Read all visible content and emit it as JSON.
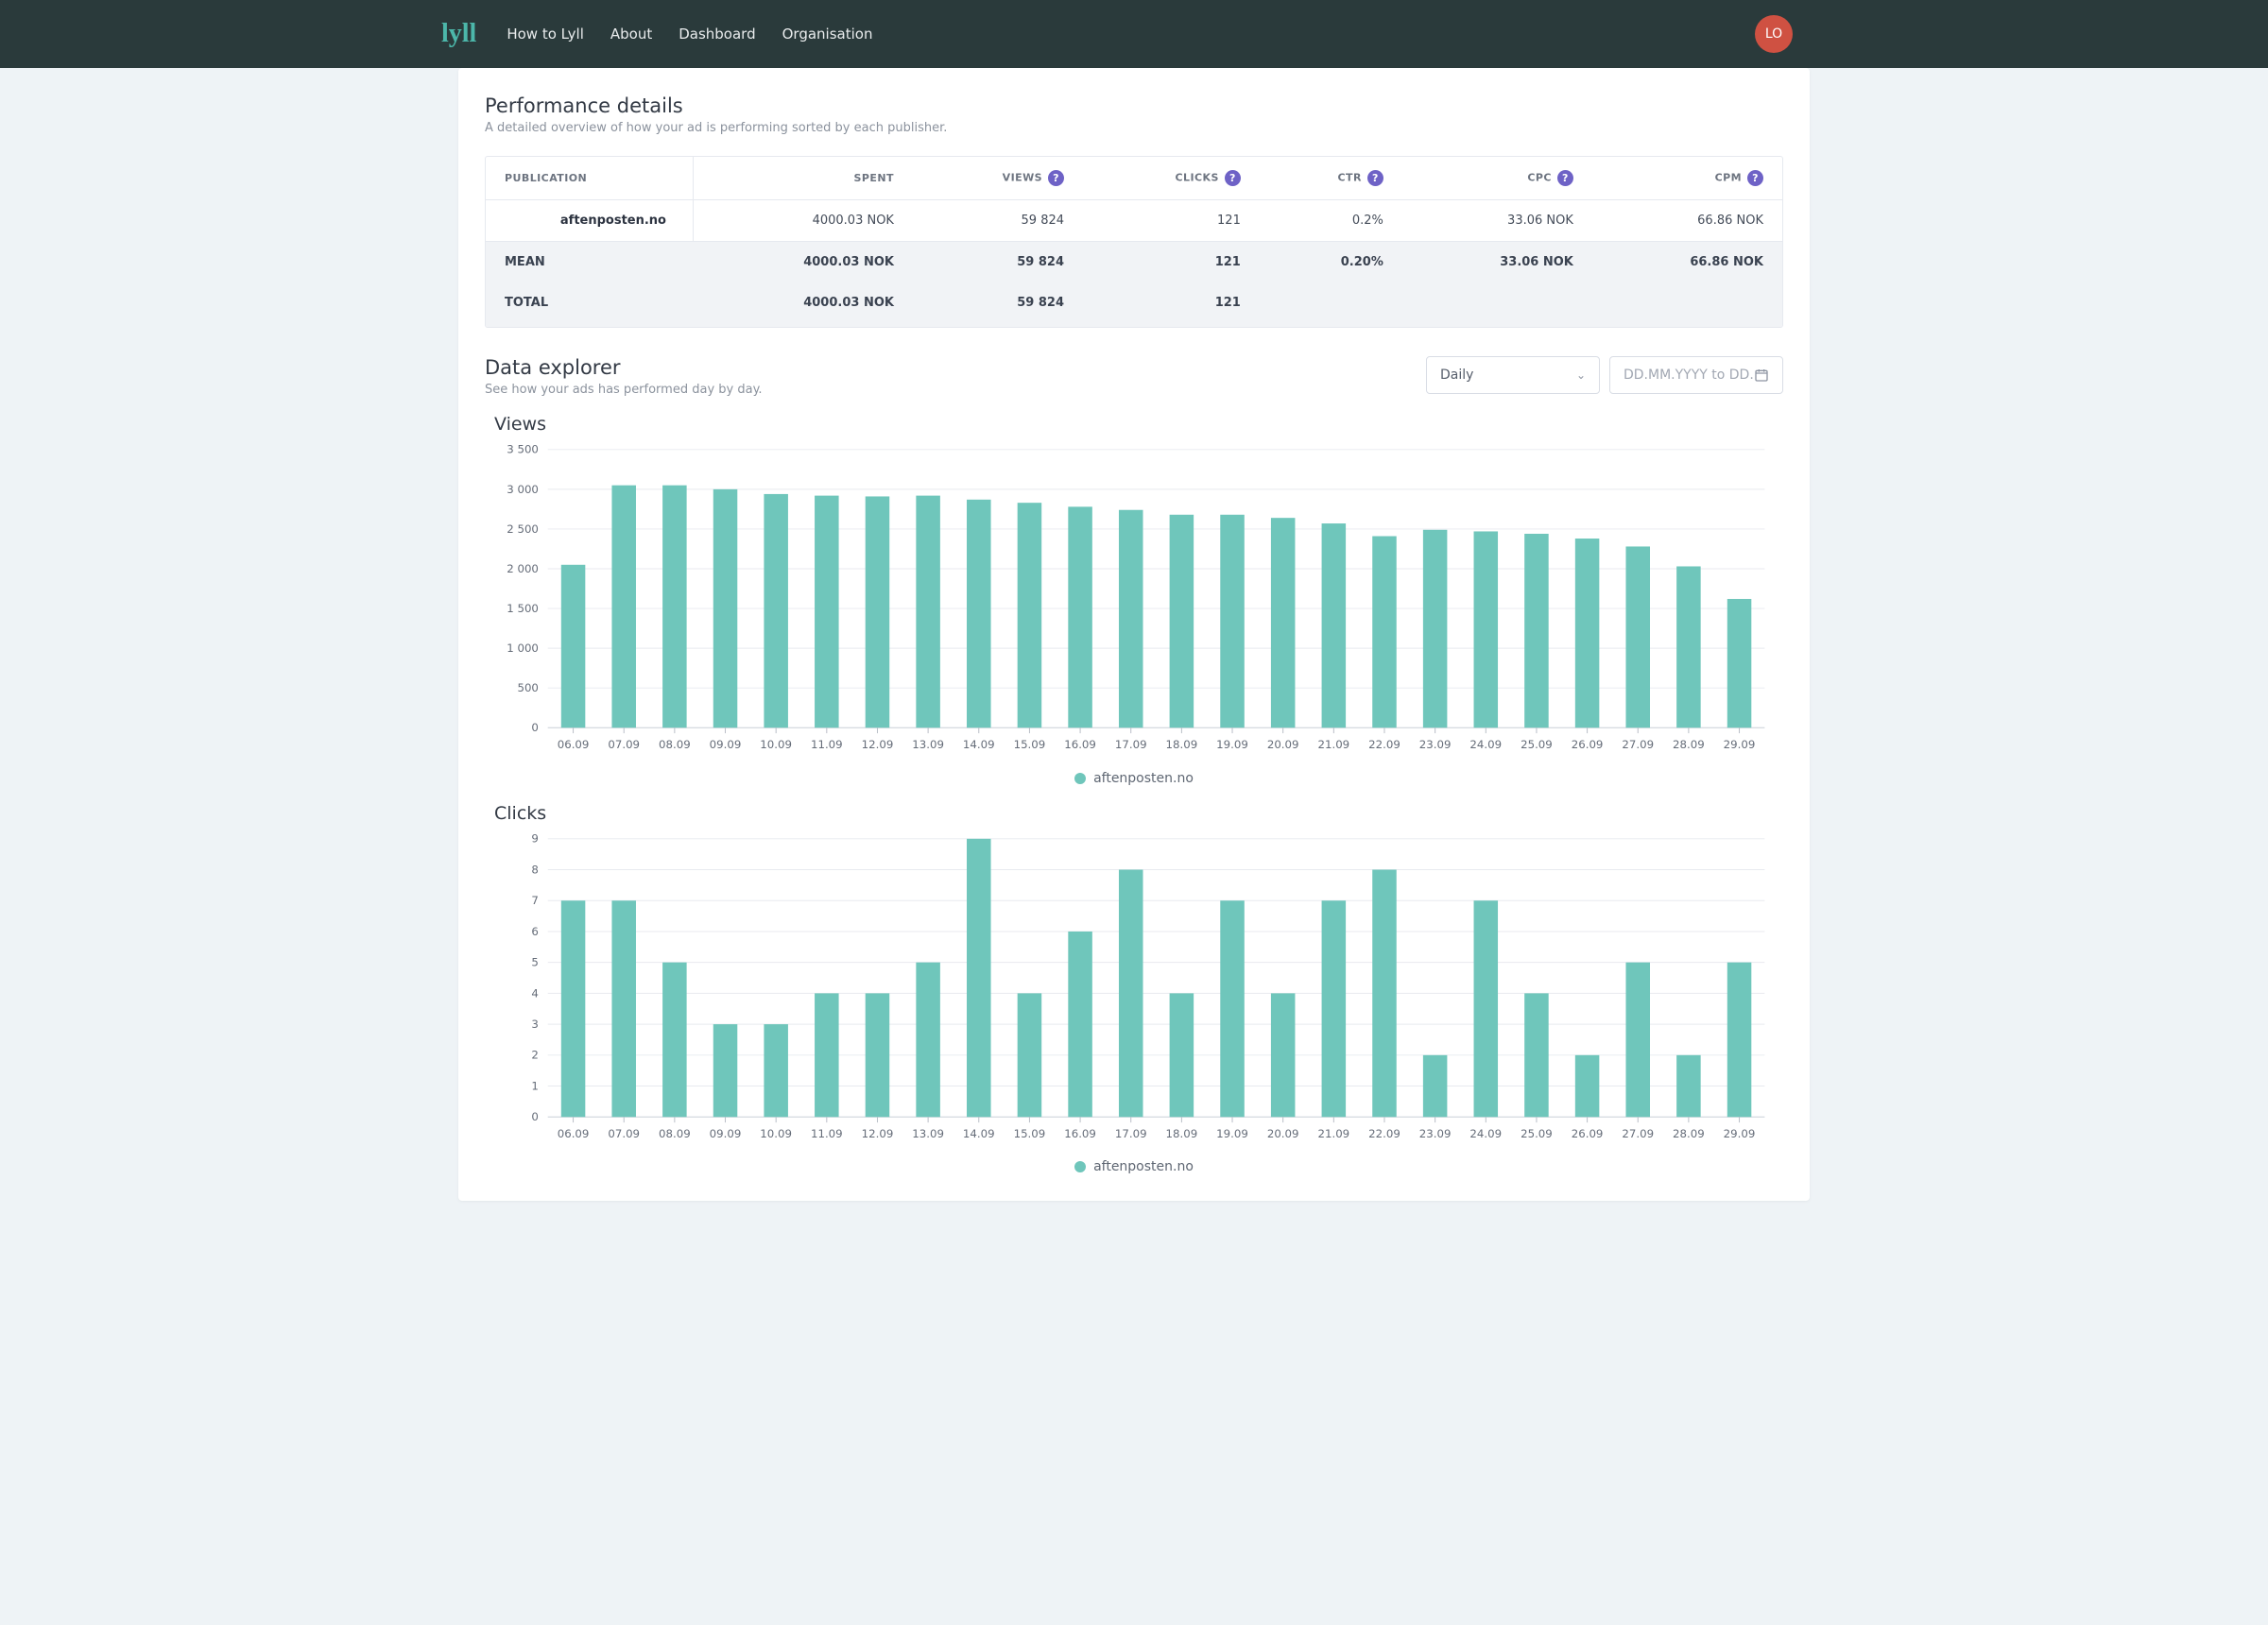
{
  "brand": "lyll",
  "nav": [
    "How to Lyll",
    "About",
    "Dashboard",
    "Organisation"
  ],
  "avatar_initials": "LO",
  "perf": {
    "title": "Performance details",
    "subtitle": "A detailed overview of how your ad is performing sorted by each publisher.",
    "columns": [
      {
        "label": "PUBLICATION",
        "help": false
      },
      {
        "label": "SPENT",
        "help": false
      },
      {
        "label": "VIEWS",
        "help": true
      },
      {
        "label": "CLICKS",
        "help": true
      },
      {
        "label": "CTR",
        "help": true
      },
      {
        "label": "CPC",
        "help": true
      },
      {
        "label": "CPM",
        "help": true
      }
    ],
    "rows": [
      {
        "publication": "aftenposten.no",
        "spent": "4000.03 NOK",
        "views": "59 824",
        "clicks": "121",
        "ctr": "0.2%",
        "cpc": "33.06 NOK",
        "cpm": "66.86 NOK"
      }
    ],
    "summary": [
      {
        "label": "MEAN",
        "spent": "4000.03 NOK",
        "views": "59 824",
        "clicks": "121",
        "ctr": "0.20%",
        "cpc": "33.06 NOK",
        "cpm": "66.86 NOK"
      },
      {
        "label": "TOTAL",
        "spent": "4000.03 NOK",
        "views": "59 824",
        "clicks": "121",
        "ctr": "",
        "cpc": "",
        "cpm": ""
      }
    ]
  },
  "explorer": {
    "title": "Data explorer",
    "subtitle": "See how your ads has performed day by day.",
    "granularity_label": "Daily",
    "date_placeholder": "DD.MM.YYYY to DD.MM.YYYY"
  },
  "legend_series": "aftenposten.no",
  "chart_data": [
    {
      "type": "bar",
      "title": "Views",
      "xlabel": "",
      "ylabel": "",
      "ylim": [
        0,
        3500
      ],
      "yticks": [
        0,
        500,
        1000,
        1500,
        2000,
        2500,
        3000,
        3500
      ],
      "ytick_labels": [
        "0",
        "500",
        "1 000",
        "1 500",
        "2 000",
        "2 500",
        "3 000",
        "3 500"
      ],
      "categories": [
        "06.09",
        "07.09",
        "08.09",
        "09.09",
        "10.09",
        "11.09",
        "12.09",
        "13.09",
        "14.09",
        "15.09",
        "16.09",
        "17.09",
        "18.09",
        "19.09",
        "20.09",
        "21.09",
        "22.09",
        "23.09",
        "24.09",
        "25.09",
        "26.09",
        "27.09",
        "28.09",
        "29.09"
      ],
      "series": [
        {
          "name": "aftenposten.no",
          "values": [
            2050,
            3050,
            3050,
            3000,
            2940,
            2920,
            2910,
            2920,
            2870,
            2830,
            2780,
            2740,
            2680,
            2680,
            2640,
            2570,
            2410,
            2490,
            2470,
            2440,
            2380,
            2280,
            2030,
            1620
          ]
        }
      ]
    },
    {
      "type": "bar",
      "title": "Clicks",
      "xlabel": "",
      "ylabel": "",
      "ylim": [
        0,
        9
      ],
      "yticks": [
        0,
        1,
        2,
        3,
        4,
        5,
        6,
        7,
        8,
        9
      ],
      "ytick_labels": [
        "0",
        "1",
        "2",
        "3",
        "4",
        "5",
        "6",
        "7",
        "8",
        "9"
      ],
      "categories": [
        "06.09",
        "07.09",
        "08.09",
        "09.09",
        "10.09",
        "11.09",
        "12.09",
        "13.09",
        "14.09",
        "15.09",
        "16.09",
        "17.09",
        "18.09",
        "19.09",
        "20.09",
        "21.09",
        "22.09",
        "23.09",
        "24.09",
        "25.09",
        "26.09",
        "27.09",
        "28.09",
        "29.09"
      ],
      "series": [
        {
          "name": "aftenposten.no",
          "values": [
            7,
            7,
            5,
            3,
            3,
            4,
            4,
            5,
            9,
            4,
            6,
            8,
            4,
            7,
            4,
            7,
            8,
            2,
            7,
            4,
            2,
            5,
            2,
            5
          ]
        }
      ]
    }
  ]
}
